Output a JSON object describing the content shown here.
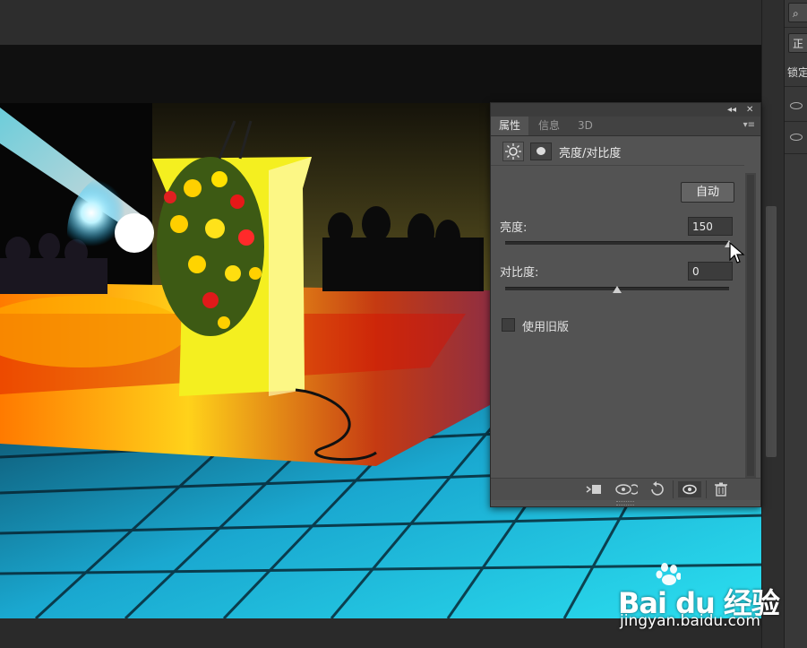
{
  "panel": {
    "collapse_glyph": "◂◂",
    "close_glyph": "✕",
    "tabs": [
      {
        "label": "属性",
        "active": true
      },
      {
        "label": "信息",
        "active": false
      },
      {
        "label": "3D",
        "active": false
      }
    ],
    "menu_glyph": "▾≡",
    "adjustment_title": "亮度/对比度",
    "auto_button": "自动",
    "brightness": {
      "label": "亮度:",
      "value": "150",
      "level": 1.0
    },
    "contrast": {
      "label": "对比度:",
      "value": "0",
      "level": 0.5
    },
    "legacy_checkbox": {
      "label": "使用旧版",
      "checked": false
    },
    "footer_icons": [
      "clip-to-layer-icon",
      "view-previous-state-icon",
      "reset-icon",
      "visibility-eye-icon",
      "trash-icon"
    ]
  },
  "dock": {
    "search_glyph": "⌕",
    "mode_button": "正",
    "lock_label": "锁定"
  },
  "watermark": {
    "brand": "Bai du 经验",
    "url": "jingyan.baidu.com"
  },
  "colors": {
    "panel_bg": "#535353",
    "workspace_bg": "#282828",
    "stage_yellow": "#f5e01a",
    "floor_cyan": "#1ec8e8"
  }
}
